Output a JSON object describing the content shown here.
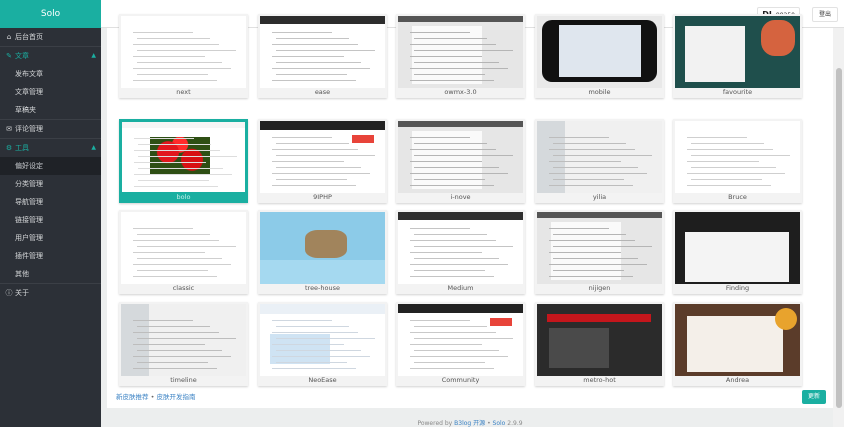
{
  "app": {
    "brand": "Solo"
  },
  "sidebar": {
    "items": [
      {
        "label": "后台首页",
        "icon": "home-icon",
        "type": "top"
      },
      {
        "label": "文章",
        "icon": "edit-icon",
        "type": "group"
      },
      {
        "label": "发布文章",
        "type": "sub"
      },
      {
        "label": "文章管理",
        "type": "sub"
      },
      {
        "label": "草稿夹",
        "type": "sub"
      },
      {
        "label": "评论管理",
        "icon": "comment-icon",
        "type": "top"
      },
      {
        "label": "工具",
        "icon": "gear-icon",
        "type": "group"
      },
      {
        "label": "偏好设定",
        "type": "sub",
        "active": true
      },
      {
        "label": "分类管理",
        "type": "sub"
      },
      {
        "label": "导航管理",
        "type": "sub"
      },
      {
        "label": "链接管理",
        "type": "sub"
      },
      {
        "label": "用户管理",
        "type": "sub"
      },
      {
        "label": "插件管理",
        "type": "sub"
      },
      {
        "label": "其他",
        "type": "sub"
      },
      {
        "label": "关于",
        "icon": "info-icon",
        "type": "top"
      }
    ]
  },
  "topbar": {
    "user_logo": "DI",
    "user_points": "88250",
    "logout": "登出"
  },
  "themes": [
    {
      "name": "next",
      "style": "white"
    },
    {
      "name": "ease",
      "style": "white-dark"
    },
    {
      "name": "owmx-3.0",
      "style": "gray"
    },
    {
      "name": "mobile",
      "style": "phone"
    },
    {
      "name": "favourite",
      "style": "teal-dark"
    },
    {
      "name": "bolo",
      "style": "red-flowers",
      "selected": true
    },
    {
      "name": "9IPHP",
      "style": "dark-bar"
    },
    {
      "name": "i-nove",
      "style": "gray"
    },
    {
      "name": "yilia",
      "style": "gray-light"
    },
    {
      "name": "Bruce",
      "style": "white"
    },
    {
      "name": "classic",
      "style": "white"
    },
    {
      "name": "tree-house",
      "style": "sky"
    },
    {
      "name": "Medium",
      "style": "white-dark"
    },
    {
      "name": "nijigen",
      "style": "gray"
    },
    {
      "name": "Finding",
      "style": "dark"
    },
    {
      "name": "timeline",
      "style": "gray-light"
    },
    {
      "name": "NeoEase",
      "style": "white-blue"
    },
    {
      "name": "Community",
      "style": "dark-bar"
    },
    {
      "name": "metro-hot",
      "style": "dark-red"
    },
    {
      "name": "Andrea",
      "style": "brown"
    }
  ],
  "bottom": {
    "link1": "新皮肤推荐",
    "separator": "•",
    "link2": "皮肤开发指南",
    "update": "更新"
  },
  "footer": {
    "powered": "Powered by",
    "b3log": "B3log 开源",
    "dot": "•",
    "solo": "Solo",
    "version": "2.9.9"
  }
}
